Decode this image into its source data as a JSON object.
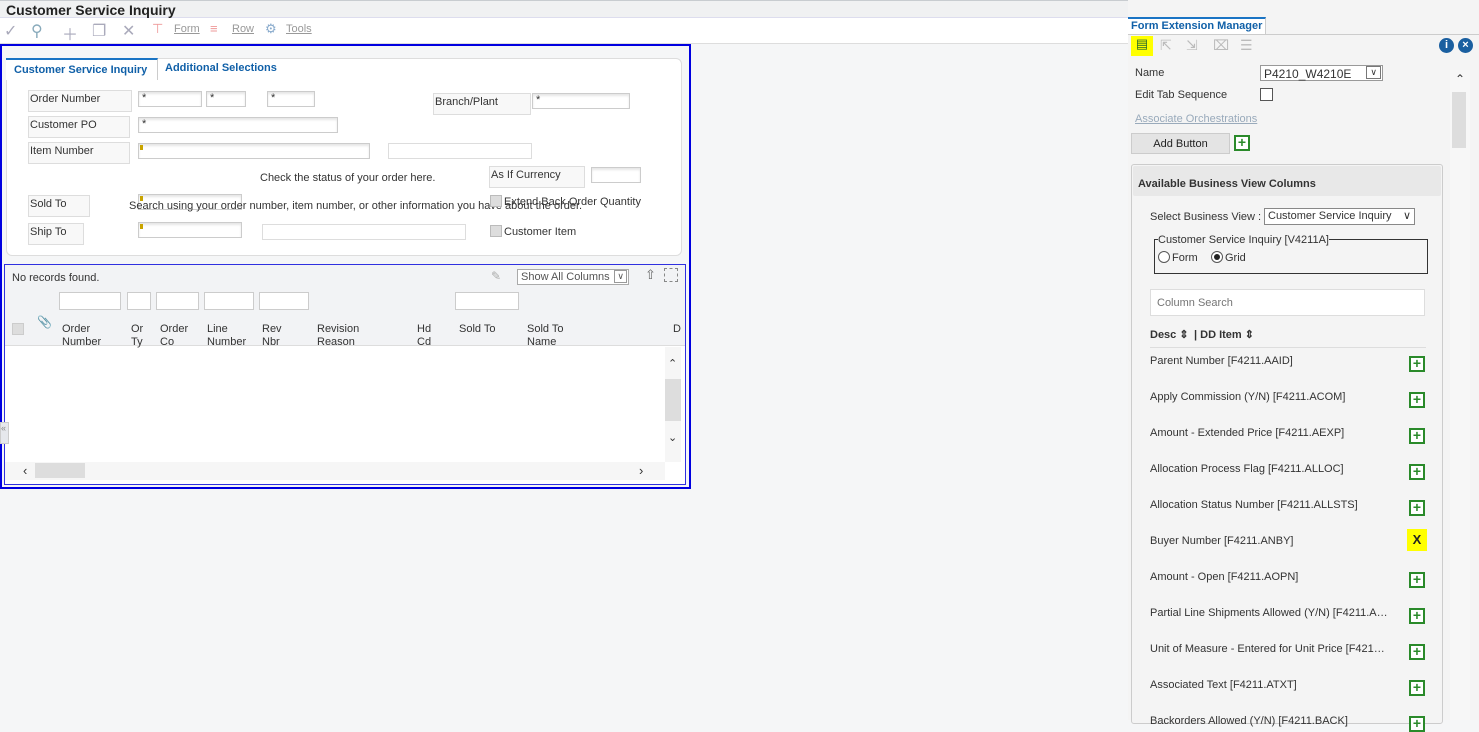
{
  "title": "Customer Service Inquiry",
  "toolbar": {
    "form": "Form",
    "row": "Row",
    "tools": "Tools",
    "icons": [
      "checkmark-icon",
      "search-icon",
      "plus-icon",
      "copy-icon",
      "close-icon",
      "form-menu-icon",
      "row-menu-icon",
      "gear-icon"
    ]
  },
  "tabs": [
    "Customer Service Inquiry",
    "Additional Selections"
  ],
  "form": {
    "order_number_label": "Order Number",
    "order_number_values": [
      "*",
      "*",
      "*"
    ],
    "branch_plant_label": "Branch/Plant",
    "branch_plant_value": "*",
    "customer_po_label": "Customer PO",
    "customer_po_value": "*",
    "item_number_label": "Item Number",
    "check_status_text": "Check the status of your order here.",
    "search_hint_text": "Search using your order number, item number, or other information you have about the order.",
    "as_if_currency_label": "As If Currency",
    "sold_to_label": "Sold To",
    "ship_to_label": "Ship To",
    "extend_back_order_label": "Extend Back Order Quantity",
    "customer_item_label": "Customer Item"
  },
  "grid": {
    "status": "No records found.",
    "column_select": "Show All Columns",
    "columns": [
      [
        "Order",
        "Number"
      ],
      [
        "Or",
        "Ty"
      ],
      [
        "Order",
        "Co"
      ],
      [
        "Line",
        "Number"
      ],
      [
        "Rev",
        "Nbr"
      ],
      [
        "Revision",
        "Reason"
      ],
      [
        "Hd",
        "Cd"
      ],
      [
        "Sold To",
        ""
      ],
      [
        "Sold To",
        "Name"
      ],
      [
        "D",
        ""
      ]
    ]
  },
  "fem": {
    "tab": "Form Extension Manager",
    "name_label": "Name",
    "name_value": "P4210_W4210E",
    "edit_tab_label": "Edit Tab Sequence",
    "associate_link": "Associate Orchestrations",
    "add_button": "Add Button",
    "section_title": "Available Business View Columns",
    "select_bv_label": "Select Business View :",
    "select_bv_value": "Customer Service Inquiry",
    "bv_group": "Customer Service Inquiry [V4211A]",
    "radio_form": "Form",
    "radio_grid": "Grid",
    "radio_selected": "Grid",
    "column_search_placeholder": "Column Search",
    "sort_desc": "Desc ⇕",
    "sort_dd": "| DD Item ⇕",
    "columns": [
      {
        "label": "Parent Number [F4211.AAID]",
        "action": "add"
      },
      {
        "label": "Apply Commission (Y/N) [F4211.ACOM]",
        "action": "add"
      },
      {
        "label": "Amount - Extended Price [F4211.AEXP]",
        "action": "add"
      },
      {
        "label": "Allocation Process Flag [F4211.ALLOC]",
        "action": "add"
      },
      {
        "label": "Allocation Status Number [F4211.ALLSTS]",
        "action": "add"
      },
      {
        "label": "Buyer Number [F4211.ANBY]",
        "action": "remove",
        "remove_label": "X"
      },
      {
        "label": "Amount - Open [F4211.AOPN]",
        "action": "add"
      },
      {
        "label": "Partial Line Shipments Allowed (Y/N) [F4211.A…",
        "action": "add"
      },
      {
        "label": "Unit of Measure - Entered for Unit Price [F421…",
        "action": "add"
      },
      {
        "label": "Associated Text [F4211.ATXT]",
        "action": "add"
      },
      {
        "label": "Backorders Allowed (Y/N) [F4211.BACK]",
        "action": "add"
      }
    ],
    "highlight_color": "#ffff00",
    "add_color": "#2a8a2a"
  }
}
